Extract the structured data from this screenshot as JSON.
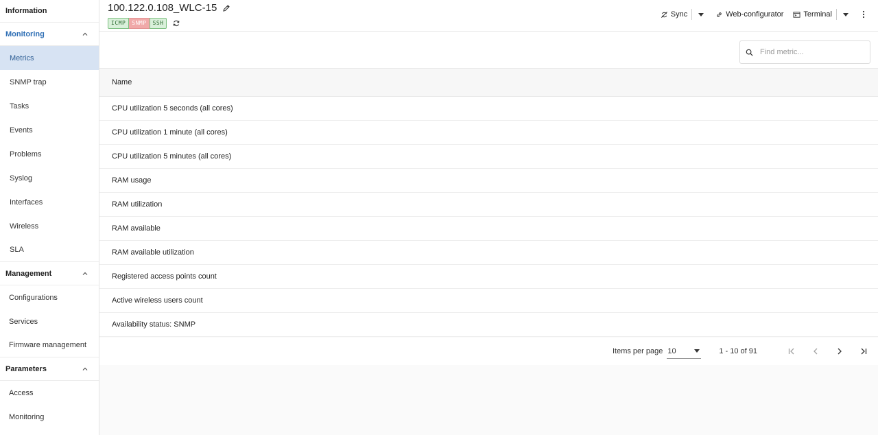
{
  "sidebar": {
    "information": "Information",
    "monitoring": {
      "label": "Monitoring",
      "items": [
        "Metrics",
        "SNMP trap",
        "Tasks",
        "Events",
        "Problems",
        "Syslog",
        "Interfaces",
        "Wireless",
        "SLA"
      ],
      "selected": "Metrics"
    },
    "management": {
      "label": "Management",
      "items": [
        "Configurations",
        "Services",
        "Firmware management"
      ]
    },
    "parameters": {
      "label": "Parameters",
      "items": [
        "Access",
        "Monitoring"
      ]
    }
  },
  "header": {
    "title": "100.122.0.108_WLC-15",
    "badges": [
      {
        "label": "ICMP",
        "status": "ok"
      },
      {
        "label": "SNMP",
        "status": "fail"
      },
      {
        "label": "SSH",
        "status": "ok"
      }
    ],
    "actions": {
      "sync": "Sync",
      "web_configurator": "Web-configurator",
      "terminal": "Terminal"
    }
  },
  "search": {
    "placeholder": "Find metric..."
  },
  "table": {
    "header": "Name",
    "rows": [
      "CPU utilization 5 seconds (all cores)",
      "CPU utilization 1 minute (all cores)",
      "CPU utilization 5 minutes (all cores)",
      "RAM usage",
      "RAM utilization",
      "RAM available",
      "RAM available utilization",
      "Registered access points count",
      "Active wireless users count",
      "Availability status: SNMP"
    ]
  },
  "paginator": {
    "items_per_page_label": "Items per page",
    "items_per_page": "10",
    "range": "1 - 10 of 91"
  },
  "colors": {
    "accent": "#2f6fb5",
    "selected_bg": "#d7e3f3",
    "badge_ok": "#d9f0da",
    "badge_fail": "#f0a9a9"
  }
}
